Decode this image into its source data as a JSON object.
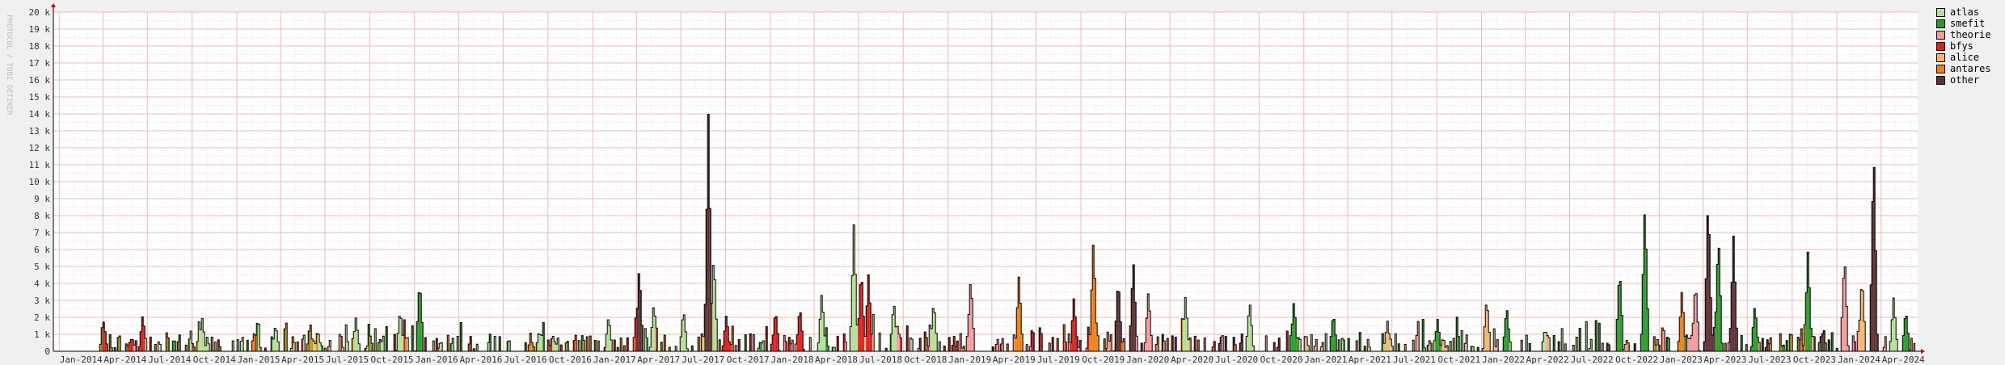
{
  "chart_data": {
    "type": "area",
    "title": "",
    "side_label": "PROTOCOL / TOBI OETIKER",
    "ylim": [
      0,
      20000
    ],
    "y_ticks": [
      {
        "value": 0,
        "label": "0"
      },
      {
        "value": 1000,
        "label": "1 k"
      },
      {
        "value": 2000,
        "label": "2 k"
      },
      {
        "value": 3000,
        "label": "3 k"
      },
      {
        "value": 4000,
        "label": "4 k"
      },
      {
        "value": 5000,
        "label": "5 k"
      },
      {
        "value": 6000,
        "label": "6 k"
      },
      {
        "value": 7000,
        "label": "7 k"
      },
      {
        "value": 8000,
        "label": "8 k"
      },
      {
        "value": 9000,
        "label": "9 k"
      },
      {
        "value": 10000,
        "label": "10 k"
      },
      {
        "value": 11000,
        "label": "11 k"
      },
      {
        "value": 12000,
        "label": "12 k"
      },
      {
        "value": 13000,
        "label": "13 k"
      },
      {
        "value": 14000,
        "label": "14 k"
      },
      {
        "value": 15000,
        "label": "15 k"
      },
      {
        "value": 16000,
        "label": "16 k"
      },
      {
        "value": 17000,
        "label": "17 k"
      },
      {
        "value": 18000,
        "label": "18 k"
      },
      {
        "value": 19000,
        "label": "19 k"
      },
      {
        "value": 20000,
        "label": "20 k"
      }
    ],
    "x_ticks": [
      "Jan-2014",
      "Apr-2014",
      "Jul-2014",
      "Oct-2014",
      "Jan-2015",
      "Apr-2015",
      "Jul-2015",
      "Oct-2015",
      "Jan-2016",
      "Apr-2016",
      "Jul-2016",
      "Oct-2016",
      "Jan-2017",
      "Apr-2017",
      "Jul-2017",
      "Oct-2017",
      "Jan-2018",
      "Apr-2018",
      "Jul-2018",
      "Oct-2018",
      "Jan-2019",
      "Apr-2019",
      "Jul-2019",
      "Oct-2019",
      "Jan-2020",
      "Apr-2020",
      "Jul-2020",
      "Oct-2020",
      "Jan-2021",
      "Apr-2021",
      "Jul-2021",
      "Oct-2021",
      "Jan-2022",
      "Apr-2022",
      "Jul-2022",
      "Oct-2022",
      "Jan-2023",
      "Apr-2023",
      "Jul-2023",
      "Oct-2023",
      "Jan-2024",
      "Apr-2024"
    ],
    "series": [
      {
        "name": "atlas",
        "color": "#b3e094"
      },
      {
        "name": "smefit",
        "color": "#2a9a2a"
      },
      {
        "name": "theorie",
        "color": "#f49a9a"
      },
      {
        "name": "bfys",
        "color": "#e01c1c"
      },
      {
        "name": "alice",
        "color": "#f5b56a"
      },
      {
        "name": "antares",
        "color": "#ef7f12"
      },
      {
        "name": "other",
        "color": "#5a3030"
      }
    ],
    "peaks": [
      {
        "date": "2014-04-01",
        "series": "bfys",
        "value": 1800
      },
      {
        "date": "2014-06-20",
        "series": "bfys",
        "value": 2200
      },
      {
        "date": "2014-10-20",
        "series": "atlas",
        "value": 2000
      },
      {
        "date": "2015-03-20",
        "series": "atlas",
        "value": 1600
      },
      {
        "date": "2015-06-15",
        "series": "atlas",
        "value": 1200
      },
      {
        "date": "2015-09-01",
        "series": "atlas",
        "value": 2000
      },
      {
        "date": "2015-12-01",
        "series": "atlas",
        "value": 2500
      },
      {
        "date": "2016-01-10",
        "series": "smefit",
        "value": 4300
      },
      {
        "date": "2016-09-15",
        "series": "atlas",
        "value": 1200
      },
      {
        "date": "2017-02-01",
        "series": "atlas",
        "value": 2100
      },
      {
        "date": "2017-04-05",
        "series": "other",
        "value": 5100
      },
      {
        "date": "2017-05-05",
        "series": "atlas",
        "value": 2900
      },
      {
        "date": "2017-07-05",
        "series": "atlas",
        "value": 2500
      },
      {
        "date": "2017-08-25",
        "series": "other",
        "value": 14000
      },
      {
        "date": "2017-09-05",
        "series": "atlas",
        "value": 5800
      },
      {
        "date": "2017-10-01",
        "series": "bfys",
        "value": 2200
      },
      {
        "date": "2018-01-10",
        "series": "bfys",
        "value": 2500
      },
      {
        "date": "2018-03-01",
        "series": "bfys",
        "value": 2700
      },
      {
        "date": "2018-04-15",
        "series": "atlas",
        "value": 3500
      },
      {
        "date": "2018-06-20",
        "series": "atlas",
        "value": 7500
      },
      {
        "date": "2018-07-05",
        "series": "bfys",
        "value": 5000
      },
      {
        "date": "2018-07-20",
        "series": "bfys",
        "value": 4600
      },
      {
        "date": "2018-09-10",
        "series": "atlas",
        "value": 3000
      },
      {
        "date": "2018-12-01",
        "series": "atlas",
        "value": 3000
      },
      {
        "date": "2019-02-15",
        "series": "theorie",
        "value": 4400
      },
      {
        "date": "2019-05-25",
        "series": "antares",
        "value": 4500
      },
      {
        "date": "2019-09-15",
        "series": "bfys",
        "value": 3200
      },
      {
        "date": "2019-10-25",
        "series": "antares",
        "value": 6600
      },
      {
        "date": "2019-12-15",
        "series": "other",
        "value": 4400
      },
      {
        "date": "2020-01-15",
        "series": "other",
        "value": 5500
      },
      {
        "date": "2020-02-15",
        "series": "theorie",
        "value": 3600
      },
      {
        "date": "2020-05-01",
        "series": "atlas",
        "value": 3200
      },
      {
        "date": "2020-09-10",
        "series": "atlas",
        "value": 3000
      },
      {
        "date": "2020-12-10",
        "series": "smefit",
        "value": 3000
      },
      {
        "date": "2021-03-01",
        "series": "smefit",
        "value": 2300
      },
      {
        "date": "2021-06-20",
        "series": "alice",
        "value": 1800
      },
      {
        "date": "2021-10-01",
        "series": "smefit",
        "value": 1900
      },
      {
        "date": "2022-01-10",
        "series": "alice",
        "value": 3200
      },
      {
        "date": "2022-02-20",
        "series": "smefit",
        "value": 2700
      },
      {
        "date": "2022-05-10",
        "series": "atlas",
        "value": 1400
      },
      {
        "date": "2022-10-10",
        "series": "smefit",
        "value": 5000
      },
      {
        "date": "2022-12-01",
        "series": "smefit",
        "value": 8800
      },
      {
        "date": "2023-02-15",
        "series": "antares",
        "value": 3600
      },
      {
        "date": "2023-03-15",
        "series": "theorie",
        "value": 4200
      },
      {
        "date": "2023-04-10",
        "series": "other",
        "value": 9300
      },
      {
        "date": "2023-05-01",
        "series": "smefit",
        "value": 7000
      },
      {
        "date": "2023-06-01",
        "series": "other",
        "value": 6800
      },
      {
        "date": "2023-07-15",
        "series": "smefit",
        "value": 2800
      },
      {
        "date": "2023-11-01",
        "series": "smefit",
        "value": 6000
      },
      {
        "date": "2024-01-15",
        "series": "theorie",
        "value": 5800
      },
      {
        "date": "2024-02-20",
        "series": "alice",
        "value": 4500
      },
      {
        "date": "2024-03-15",
        "series": "other",
        "value": 12300
      },
      {
        "date": "2024-04-25",
        "series": "atlas",
        "value": 3200
      },
      {
        "date": "2024-05-20",
        "series": "smefit",
        "value": 2500
      }
    ]
  }
}
